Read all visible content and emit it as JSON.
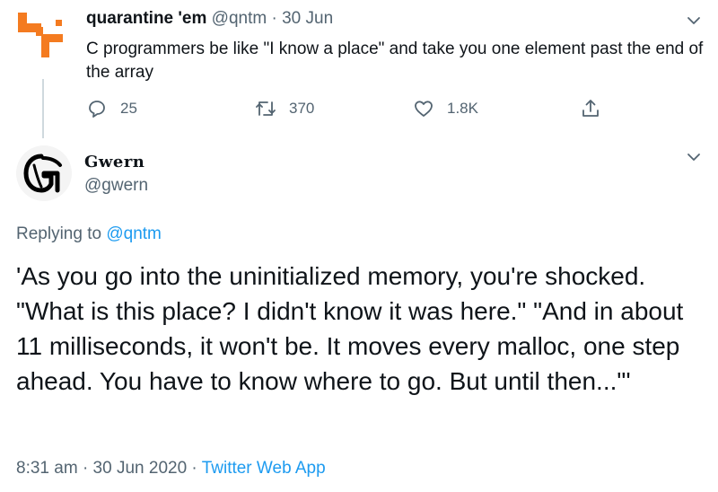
{
  "parent": {
    "name": "quarantine 'em",
    "handle": "@qntm",
    "separator": "·",
    "date": "30 Jun",
    "text": "C programmers be like \"I know a place\" and take you one element past the end of the array",
    "actions": {
      "reply_count": "25",
      "retweet_count": "370",
      "like_count": "1.8K"
    },
    "avatar_icon": "qntm-logo-icon"
  },
  "tweet": {
    "name": "Gwern",
    "handle": "@gwern",
    "replying_prefix": "Replying to",
    "replying_to": "@qntm",
    "text": "'As you go into the uninitialized memory, you're shocked. \"What is this place? I didn't know it was here.\" \"And in about 11 milliseconds, it won't be. It moves every malloc, one step ahead. You have to know where to go. But until then...\"'",
    "time": "8:31 am",
    "separator1": "·",
    "date": "30 Jun 2020",
    "separator2": "·",
    "client": "Twitter Web App",
    "avatar_icon": "gwern-logo-icon"
  },
  "colors": {
    "accent": "#1d9bf0",
    "secondary_text": "#536471",
    "logo_orange": "#f47b20"
  }
}
